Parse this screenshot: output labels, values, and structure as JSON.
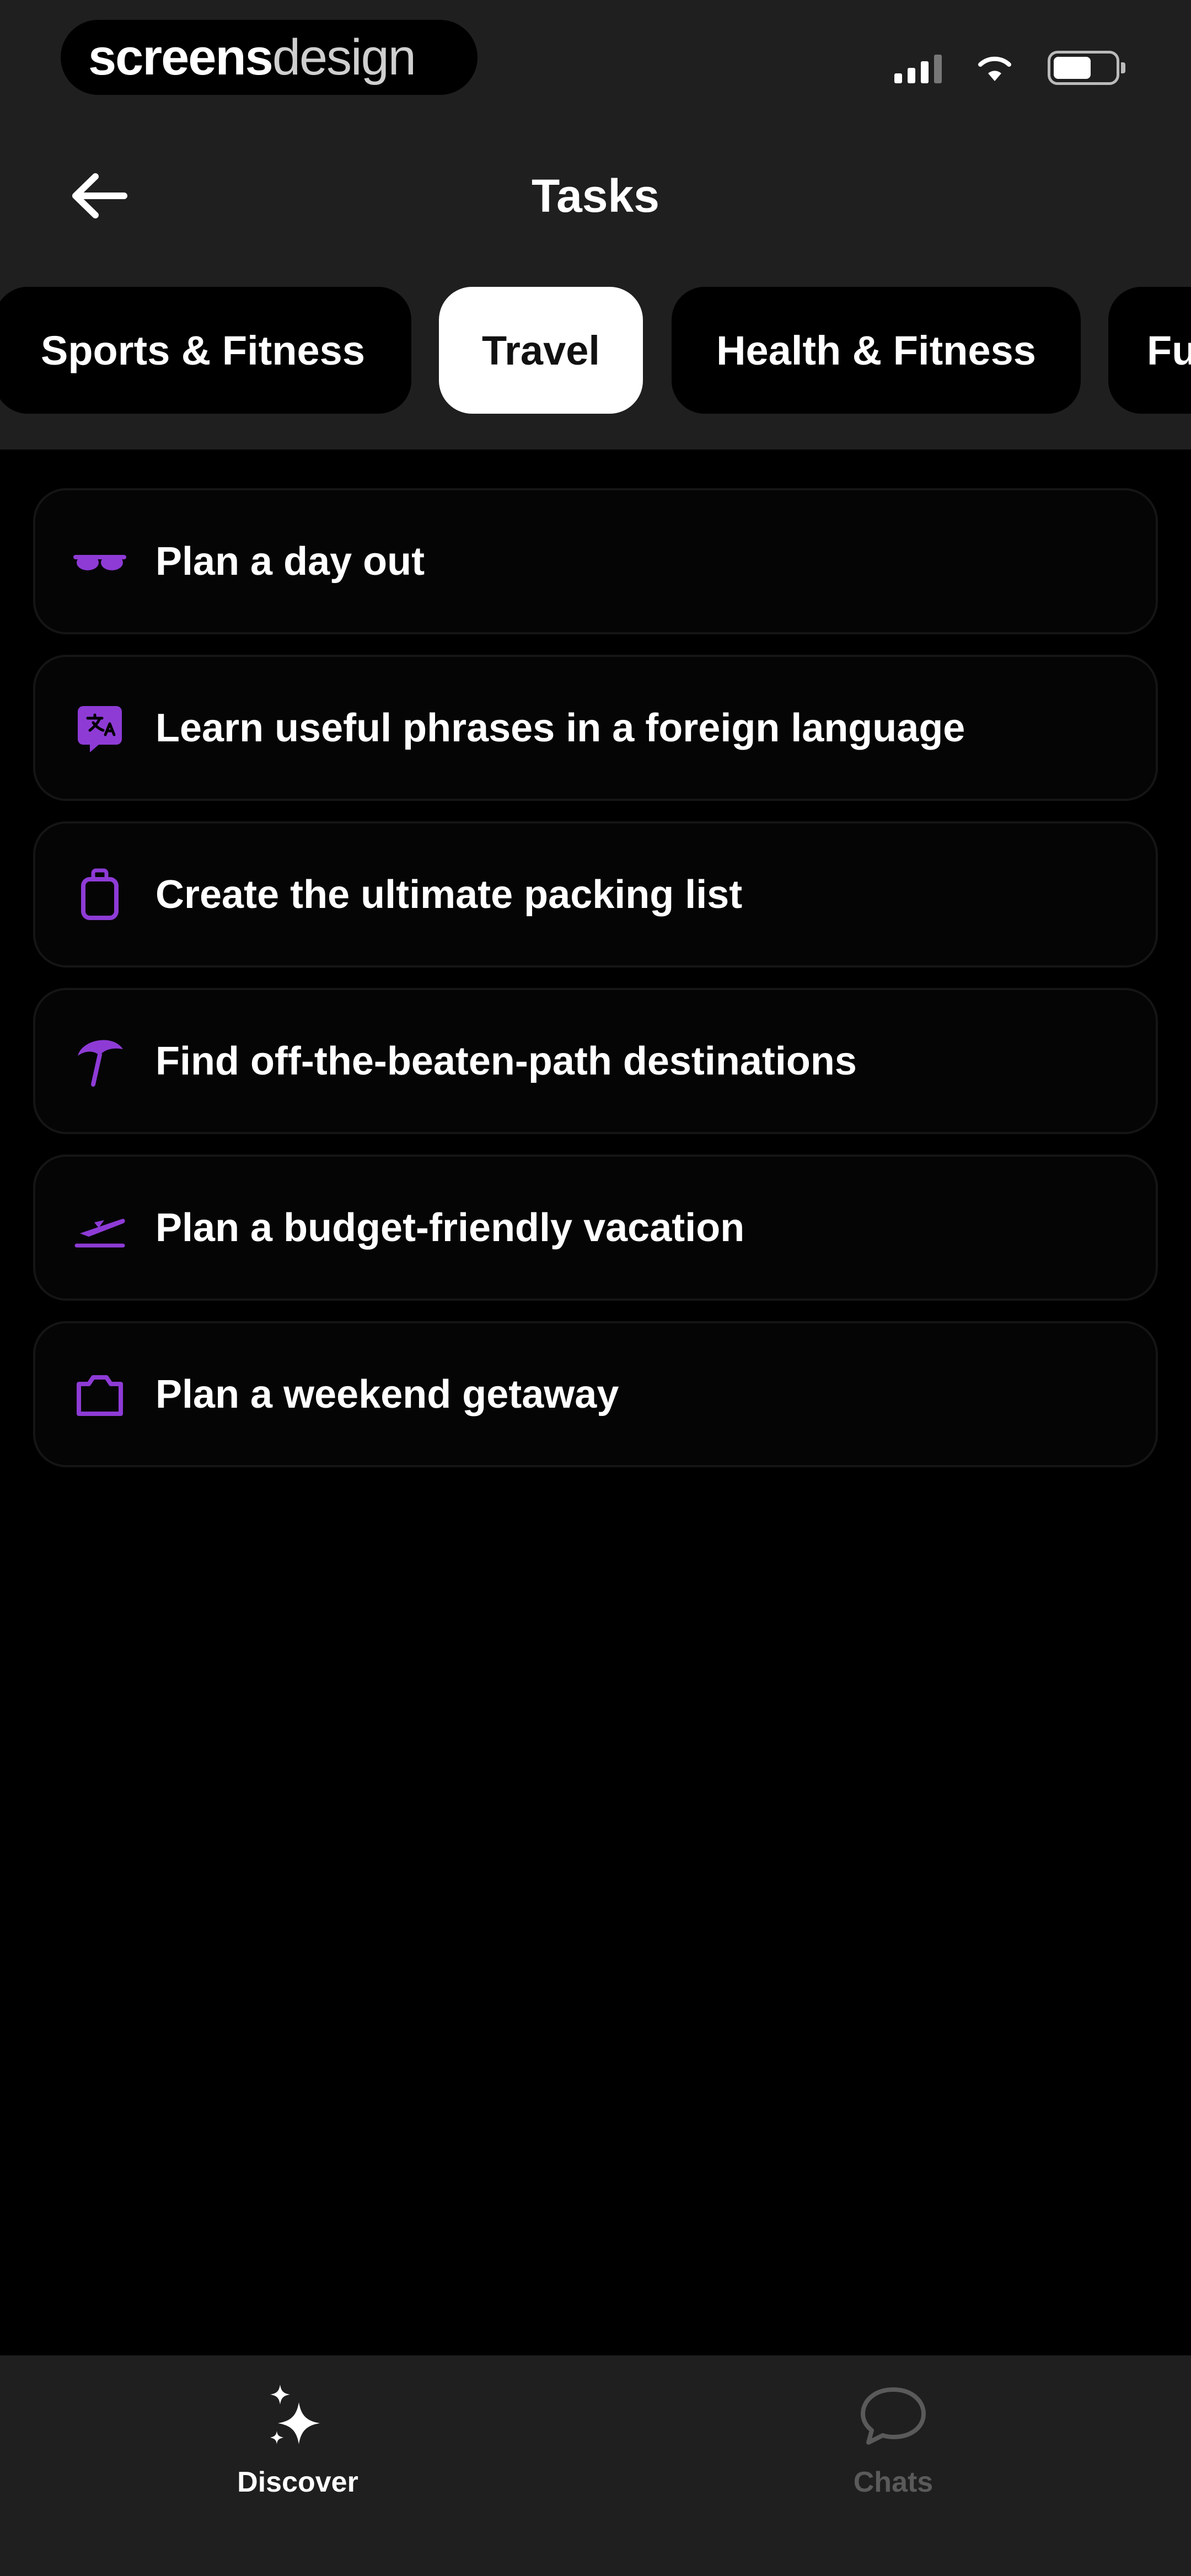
{
  "status_bar": {
    "brand_primary": "screens",
    "brand_secondary": "design",
    "icons": [
      "signal-icon",
      "wifi-icon",
      "battery-icon"
    ]
  },
  "header": {
    "title": "Tasks",
    "back_icon": "arrow-left-icon"
  },
  "categories": [
    {
      "label": "Sports & Fitness",
      "active": false
    },
    {
      "label": "Travel",
      "active": true
    },
    {
      "label": "Health & Fitness",
      "active": false
    },
    {
      "label": "Fu",
      "active": false
    }
  ],
  "tasks": [
    {
      "label": "Plan a day out",
      "icon": "sunglasses-icon"
    },
    {
      "label": "Learn useful phrases in a foreign language",
      "icon": "translate-icon"
    },
    {
      "label": "Create the ultimate packing list",
      "icon": "luggage-icon"
    },
    {
      "label": "Find off-the-beaten-path destinations",
      "icon": "beach-umbrella-icon"
    },
    {
      "label": "Plan a budget-friendly vacation",
      "icon": "airplane-takeoff-icon"
    },
    {
      "label": "Plan a weekend getaway",
      "icon": "camera-icon"
    }
  ],
  "tabbar": {
    "items": [
      {
        "label": "Discover",
        "icon": "sparkles-icon",
        "active": true
      },
      {
        "label": "Chats",
        "icon": "chat-bubble-icon",
        "active": false
      }
    ]
  },
  "colors": {
    "accent": "#8e3bd6",
    "header_bg": "#1f1f1f",
    "page_bg": "#000000",
    "active_chip_bg": "#ffffff",
    "inactive_tab": "#5a5a5a"
  }
}
